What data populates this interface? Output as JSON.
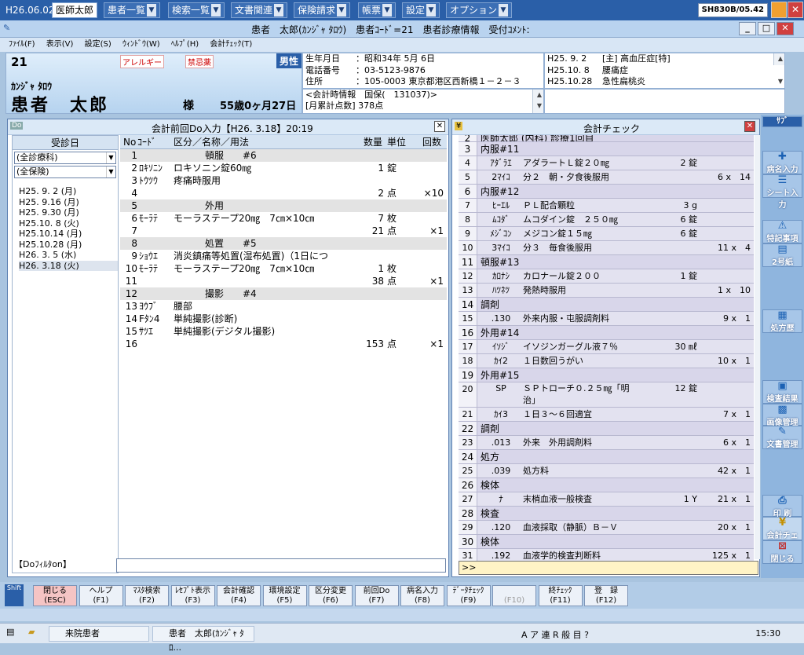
{
  "topbar": {
    "date": "H26.06.02",
    "user": "医師太郎",
    "menus": [
      "患者一覧",
      "検索一覧",
      "文書関連",
      "保険請求",
      "帳票",
      "設定",
      "オプション"
    ],
    "version": "SH830B/05.42"
  },
  "titlebar": {
    "title": "患者　太郎(ｶﾝｼﾞｬ ﾀﾛｳ)　患者ｺｰﾄﾞ=21　患者診療情報　受付ｺﾒﾝﾄ:"
  },
  "menubar": [
    "ﾌｧｲﾙ(F)",
    "表示(V)",
    "設定(S)",
    "ｳｨﾝﾄﾞｳ(W)",
    "ﾍﾙﾌﾟ(H)",
    "会計ﾁｪｯｸ(T)"
  ],
  "patient": {
    "id": "21",
    "allergy": "アレルギー",
    "forbidden": "禁忌薬",
    "sex": "男性",
    "kana": "ｶﾝｼﾞｬ ﾀﾛｳ",
    "name": "患者　太郎",
    "honorific": "様",
    "age": "55歳0ヶ月27日"
  },
  "info": [
    {
      "k": "生年月日",
      "v": "：昭和34年 5月 6日"
    },
    {
      "k": "電話番号",
      "v": "：03-5123-9876"
    },
    {
      "k": "住所",
      "v": "：105-0003 東京都港区西新橋１－２－３"
    }
  ],
  "info2": [
    "<会計時情報　国保(　131037)>",
    "[月累計点数] 378点"
  ],
  "diseases": [
    {
      "d": "H25. 9. 2",
      "n": "[主] 高血圧症[特]"
    },
    {
      "d": "H25.10. 8",
      "n": "腰痛症"
    },
    {
      "d": "H25.10.28",
      "n": "急性扁桃炎"
    }
  ],
  "dopanel": {
    "title": "会計前回Do入力【H26. 3.18】20:19",
    "date_header": "受診日",
    "dept_select": "(全診療科)",
    "ins_select": "(全保険)",
    "dates": [
      "H25. 9. 2 (月)",
      "H25. 9.16 (月)",
      "H25. 9.30 (月)",
      "H25.10. 8 (火)",
      "H25.10.14 (月)",
      "H25.10.28 (月)",
      "H26. 3. 5 (水)",
      "H26. 3.18 (火)"
    ],
    "filter_label": "【Doﾌｨﾙﾀon】",
    "headers": {
      "no": "No",
      "code": "ｺｰﾄﾞ",
      "name": "区分／名称／用法",
      "qty": "数量",
      "unit": "単位",
      "times": "回数"
    },
    "rows": [
      {
        "no": "1",
        "code": "",
        "name": "頓服　　#6",
        "qty": "",
        "unit": "",
        "times": "",
        "grp": true
      },
      {
        "no": "2",
        "code": "ﾛｷｿﾆﾝ",
        "name": "ロキソニン錠60㎎",
        "qty": "1",
        "unit": "錠",
        "times": ""
      },
      {
        "no": "3",
        "code": "ﾄｳﾂｳ",
        "name": "疼痛時服用",
        "qty": "",
        "unit": "",
        "times": ""
      },
      {
        "no": "4",
        "code": "",
        "name": "",
        "qty": "2",
        "unit": "点",
        "times": "×10"
      },
      {
        "no": "5",
        "code": "",
        "name": "外用",
        "qty": "",
        "unit": "",
        "times": "",
        "grp": true
      },
      {
        "no": "6",
        "code": "ﾓｰﾗﾃ",
        "name": "モーラステープ20㎎　7㎝×10㎝",
        "qty": "7",
        "unit": "枚",
        "times": ""
      },
      {
        "no": "7",
        "code": "",
        "name": "",
        "qty": "21",
        "unit": "点",
        "times": "×1"
      },
      {
        "no": "8",
        "code": "",
        "name": "処置　　#5",
        "qty": "",
        "unit": "",
        "times": "",
        "grp": true
      },
      {
        "no": "9",
        "code": "ｼｮｳｴ",
        "name": "消炎鎮痛等処置(湿布処置)（1日につ",
        "qty": "",
        "unit": "",
        "times": ""
      },
      {
        "no": "10",
        "code": "ﾓｰﾗﾃ",
        "name": "モーラステープ20㎎　7㎝×10㎝",
        "qty": "1",
        "unit": "枚",
        "times": ""
      },
      {
        "no": "11",
        "code": "",
        "name": "",
        "qty": "38",
        "unit": "点",
        "times": "×1"
      },
      {
        "no": "12",
        "code": "",
        "name": "撮影　　#4",
        "qty": "",
        "unit": "",
        "times": "",
        "grp": true
      },
      {
        "no": "13",
        "code": "ﾖｳﾌﾞ",
        "name": "腰部",
        "qty": "",
        "unit": "",
        "times": ""
      },
      {
        "no": "14",
        "code": "Fﾀﾝ4",
        "name": "単純撮影(診断)",
        "qty": "",
        "unit": "",
        "times": ""
      },
      {
        "no": "15",
        "code": "ｻﾂｴ",
        "name": "単純撮影(デジタル撮影)",
        "qty": "",
        "unit": "",
        "times": ""
      },
      {
        "no": "16",
        "code": "",
        "name": "",
        "qty": "153",
        "unit": "点",
        "times": "×1"
      }
    ]
  },
  "chkpanel": {
    "title": "会計チェック",
    "rows": [
      {
        "no": "2",
        "code": "",
        "name": "医師太郎 (内科) 診療1回目",
        "qty": "",
        "pts": "",
        "t": "grp"
      },
      {
        "no": "3",
        "code": "",
        "name": "内服#11",
        "qty": "",
        "pts": "",
        "t": "grp"
      },
      {
        "no": "4",
        "code": "ｱﾀﾞﾗｴ",
        "name": "アダラートＬ錠２０㎎",
        "qty": "2 錠",
        "pts": ""
      },
      {
        "no": "5",
        "code": "2ﾏｲｺ",
        "name": "分２　朝・夕食後服用",
        "qty": "",
        "pts": "6 x　14"
      },
      {
        "no": "6",
        "code": "",
        "name": "内服#12",
        "qty": "",
        "pts": "",
        "t": "grp"
      },
      {
        "no": "7",
        "code": "ﾋｰｴﾙ",
        "name": "ＰＬ配合顆粒",
        "qty": "3 g",
        "pts": ""
      },
      {
        "no": "8",
        "code": "ﾑｺﾀﾞ",
        "name": "ムコダイン錠　２５０㎎",
        "qty": "6 錠",
        "pts": ""
      },
      {
        "no": "9",
        "code": "ﾒｼﾞｺﾝ",
        "name": "メジコン錠１５㎎",
        "qty": "6 錠",
        "pts": ""
      },
      {
        "no": "10",
        "code": "3ﾏｲｺ",
        "name": "分３　毎食後服用",
        "qty": "",
        "pts": "11 x　4"
      },
      {
        "no": "11",
        "code": "",
        "name": "頓服#13",
        "qty": "",
        "pts": "",
        "t": "grp"
      },
      {
        "no": "12",
        "code": "ｶﾛﾅｼ",
        "name": "カロナール錠２００",
        "qty": "1 錠",
        "pts": ""
      },
      {
        "no": "13",
        "code": "ﾊﾂﾈﾂ",
        "name": "発熱時服用",
        "qty": "",
        "pts": "1 x　10"
      },
      {
        "no": "14",
        "code": "",
        "name": "調剤",
        "qty": "",
        "pts": "",
        "t": "grp"
      },
      {
        "no": "15",
        "code": ".130",
        "name": "外来内服・屯服調剤料",
        "qty": "",
        "pts": "9 x　1"
      },
      {
        "no": "16",
        "code": "",
        "name": "外用#14",
        "qty": "",
        "pts": "",
        "t": "grp"
      },
      {
        "no": "17",
        "code": "ｲｿｼﾞ",
        "name": "イソジンガーグル液７％",
        "qty": "30 ㎖",
        "pts": ""
      },
      {
        "no": "18",
        "code": "ｶｲ2",
        "name": "１日数回うがい",
        "qty": "",
        "pts": "10 x　1"
      },
      {
        "no": "19",
        "code": "",
        "name": "外用#15",
        "qty": "",
        "pts": "",
        "t": "grp"
      },
      {
        "no": "20",
        "code": "SP",
        "name": "ＳＰトローチ０.２５㎎「明",
        "name2": "治」",
        "qty": "12 錠",
        "pts": "",
        "t": "tall"
      },
      {
        "no": "21",
        "code": "ｶｲ3",
        "name": "１日３～６回適宜",
        "qty": "",
        "pts": "7 x　1"
      },
      {
        "no": "22",
        "code": "",
        "name": "調剤",
        "qty": "",
        "pts": "",
        "t": "grp"
      },
      {
        "no": "23",
        "code": ".013",
        "name": "外来　外用調剤料",
        "qty": "",
        "pts": "6 x　1"
      },
      {
        "no": "24",
        "code": "",
        "name": "処方",
        "qty": "",
        "pts": "",
        "t": "grp"
      },
      {
        "no": "25",
        "code": ".039",
        "name": "処方料",
        "qty": "",
        "pts": "42 x　1"
      },
      {
        "no": "26",
        "code": "",
        "name": "検体",
        "qty": "",
        "pts": "",
        "t": "grp"
      },
      {
        "no": "27",
        "code": "ﾅ",
        "name": "末梢血液一般検査",
        "qty": "1 Y",
        "pts": "21 x　1"
      },
      {
        "no": "28",
        "code": "",
        "name": "検査",
        "qty": "",
        "pts": "",
        "t": "grp"
      },
      {
        "no": "29",
        "code": ".120",
        "name": "血液採取（静脈）Ｂ－Ｖ",
        "qty": "",
        "pts": "20 x　1"
      },
      {
        "no": "30",
        "code": "",
        "name": "検体",
        "qty": "",
        "pts": "",
        "t": "grp"
      },
      {
        "no": "31",
        "code": ".192",
        "name": "血液学的検査判断料",
        "qty": "",
        "pts": "125 x　1"
      }
    ],
    "input_prompt": ">>"
  },
  "sidebar": {
    "tab": "ｻﾌﾞ",
    "buttons": [
      {
        "label": "病名入力",
        "icon": "✚"
      },
      {
        "label": "シート入力",
        "icon": "☰"
      },
      {
        "label": "特記事項",
        "icon": "⚠"
      },
      {
        "label": "2号紙",
        "icon": "▤"
      },
      {
        "label": "処方歴",
        "icon": "▦"
      },
      {
        "label": "検査結果",
        "icon": "▣"
      },
      {
        "label": "画像管理",
        "icon": "▩"
      },
      {
        "label": "文書管理",
        "icon": "✎"
      },
      {
        "label": "印 刷",
        "icon": "⎙"
      },
      {
        "label": "会計チェック",
        "icon": "¥"
      },
      {
        "label": "閉じる",
        "icon": "⊠"
      }
    ]
  },
  "fkeys": [
    {
      "l1": "閉じる",
      "l2": "(ESC)"
    },
    {
      "l1": "ヘルプ",
      "l2": "(F1)"
    },
    {
      "l1": "ﾏｽﾀ検索",
      "l2": "(F2)"
    },
    {
      "l1": "ﾚｾﾌﾟﾄ表示",
      "l2": "(F3)"
    },
    {
      "l1": "会計確認",
      "l2": "(F4)"
    },
    {
      "l1": "環境設定",
      "l2": "(F5)"
    },
    {
      "l1": "区分変更",
      "l2": "(F6)"
    },
    {
      "l1": "前回Do",
      "l2": "(F7)"
    },
    {
      "l1": "病名入力",
      "l2": "(F8)"
    },
    {
      "l1": "ﾃﾞｰﾀﾁｪｯｸ",
      "l2": "(F9)"
    },
    {
      "l1": "",
      "l2": "(F10)"
    },
    {
      "l1": "終ﾁｪｯｸ",
      "l2": "(F11)"
    },
    {
      "l1": "登　録",
      "l2": "(F12)"
    }
  ],
  "shift_label": "Shift",
  "taskbar": {
    "tasks": [
      "来院患者",
      "患者　太郎(ｶﾝｼﾞｬ ﾀﾛ..."
    ],
    "tray": "A ア 連 R 般 目 ?",
    "clock": "15:30"
  }
}
